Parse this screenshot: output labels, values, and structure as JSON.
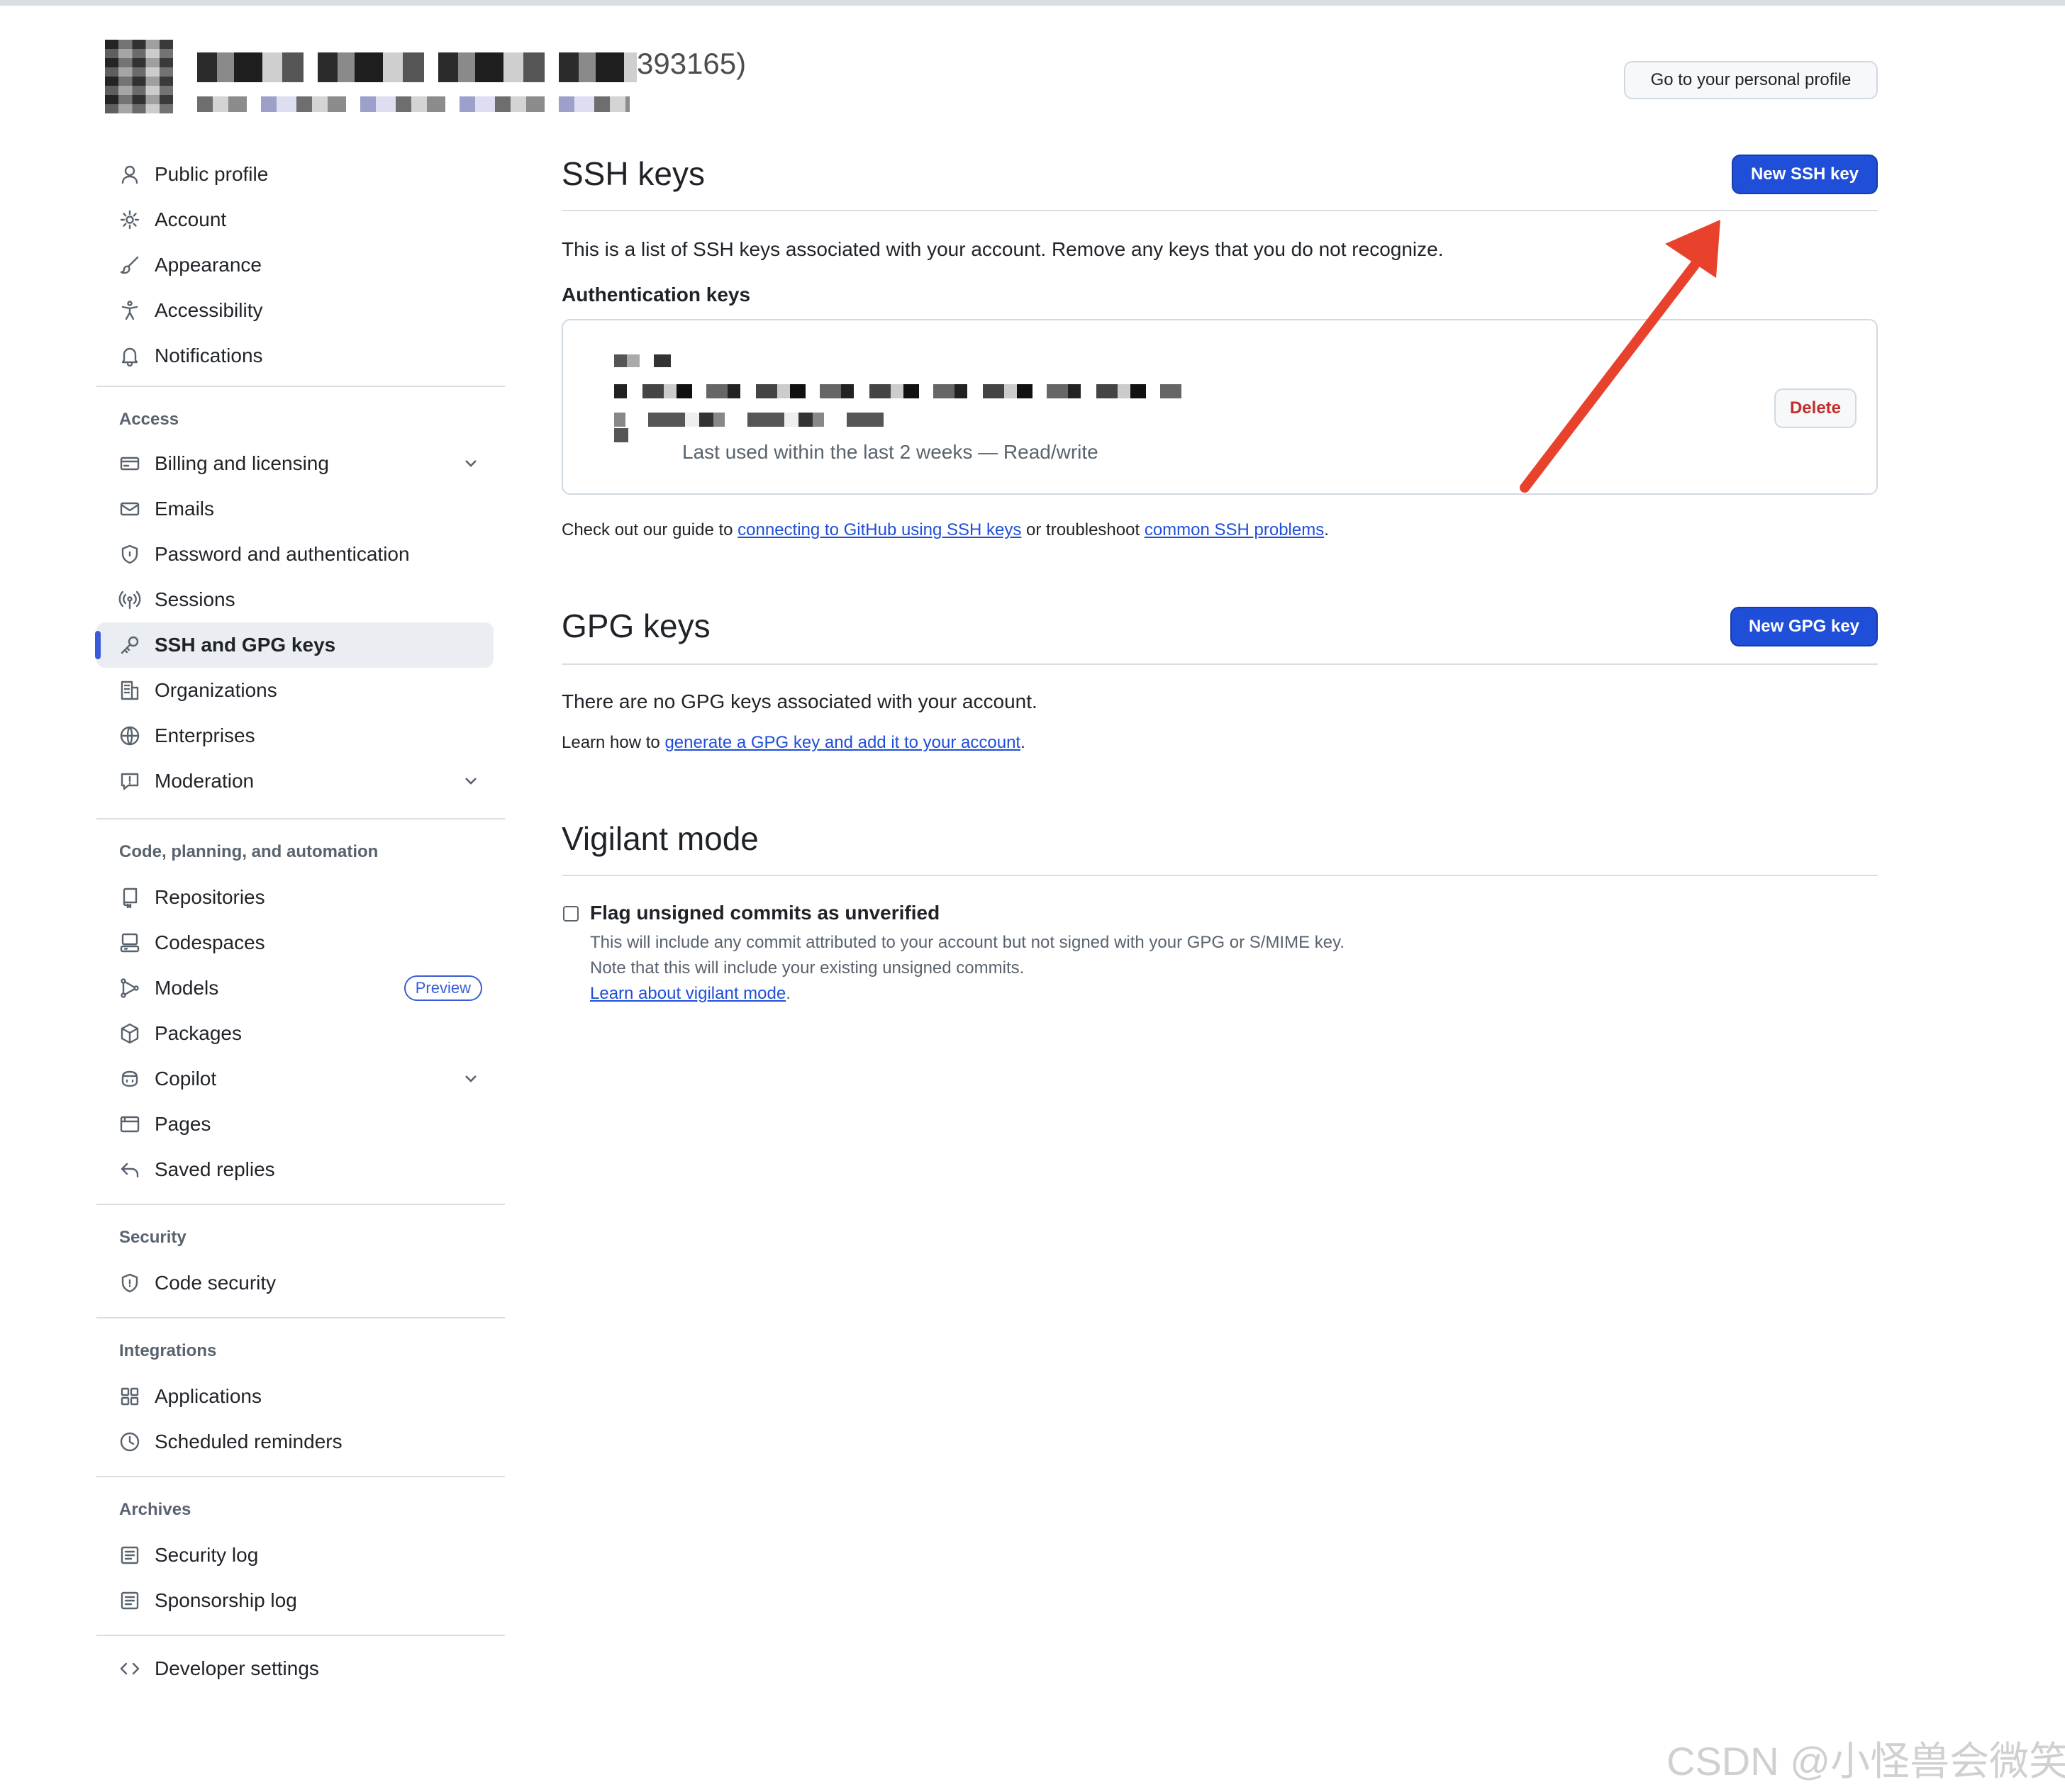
{
  "header": {
    "name_visible_tail": "393165)",
    "personal_profile_button": "Go to your personal profile"
  },
  "sidebar": {
    "items_group1": [
      {
        "label": "Public profile",
        "icon": "person-icon"
      },
      {
        "label": "Account",
        "icon": "gear-icon"
      },
      {
        "label": "Appearance",
        "icon": "paintbrush-icon"
      },
      {
        "label": "Accessibility",
        "icon": "accessibility-icon"
      },
      {
        "label": "Notifications",
        "icon": "bell-icon"
      }
    ],
    "section_access": "Access",
    "items_access": [
      {
        "label": "Billing and licensing",
        "icon": "credit-card-icon"
      },
      {
        "label": "Emails",
        "icon": "mail-icon"
      },
      {
        "label": "Password and authentication",
        "icon": "shield-lock-icon"
      },
      {
        "label": "Sessions",
        "icon": "broadcast-icon"
      },
      {
        "label": "SSH and GPG keys",
        "icon": "key-icon"
      },
      {
        "label": "Organizations",
        "icon": "organization-icon"
      },
      {
        "label": "Enterprises",
        "icon": "globe-icon"
      },
      {
        "label": "Moderation",
        "icon": "report-icon"
      }
    ],
    "section_code": "Code, planning, and automation",
    "items_code": [
      {
        "label": "Repositories",
        "icon": "repo-icon"
      },
      {
        "label": "Codespaces",
        "icon": "codespaces-icon"
      },
      {
        "label": "Models",
        "icon": "models-icon"
      },
      {
        "label": "Packages",
        "icon": "package-icon"
      },
      {
        "label": "Copilot",
        "icon": "copilot-icon"
      },
      {
        "label": "Pages",
        "icon": "browser-icon"
      },
      {
        "label": "Saved replies",
        "icon": "reply-icon"
      }
    ],
    "models_badge": "Preview",
    "section_security": "Security",
    "items_security": [
      {
        "label": "Code security",
        "icon": "shield-icon"
      }
    ],
    "section_integrations": "Integrations",
    "items_integrations": [
      {
        "label": "Applications",
        "icon": "apps-icon"
      },
      {
        "label": "Scheduled reminders",
        "icon": "clock-icon"
      }
    ],
    "section_archives": "Archives",
    "items_archives": [
      {
        "label": "Security log",
        "icon": "log-icon"
      },
      {
        "label": "Sponsorship log",
        "icon": "log-icon"
      }
    ],
    "developer_settings": {
      "label": "Developer settings",
      "icon": "code-icon"
    }
  },
  "ssh": {
    "title": "SSH keys",
    "new_button": "New SSH key",
    "description": "This is a list of SSH keys associated with your account. Remove any keys that you do not recognize.",
    "auth_heading": "Authentication keys",
    "key_meta": "Last used within the last 2 weeks — Read/write",
    "delete_button": "Delete",
    "guide_prefix": "Check out our guide to ",
    "guide_link": "connecting to GitHub using SSH keys",
    "guide_mid": " or troubleshoot ",
    "guide_link2": "common SSH problems",
    "guide_suffix": "."
  },
  "gpg": {
    "title": "GPG keys",
    "new_button": "New GPG key",
    "empty_text": "There are no GPG keys associated with your account.",
    "learn_prefix": "Learn how to ",
    "learn_link": "generate a GPG key and add it to your account",
    "learn_suffix": "."
  },
  "vigilant": {
    "title": "Vigilant mode",
    "checkbox_label": "Flag unsigned commits as unverified",
    "checked": false,
    "desc1": "This will include any commit attributed to your account but not signed with your GPG or S/MIME key.",
    "desc2": "Note that this will include your existing unsigned commits.",
    "learn_link": "Learn about vigilant mode",
    "learn_suffix": "."
  },
  "watermark": "CSDN @小怪兽会微笑",
  "colors": {
    "primary": "#1f4ed8",
    "danger": "#c22f2a",
    "annotation_arrow": "#e8412c",
    "active_indicator": "#3a5bd9"
  }
}
